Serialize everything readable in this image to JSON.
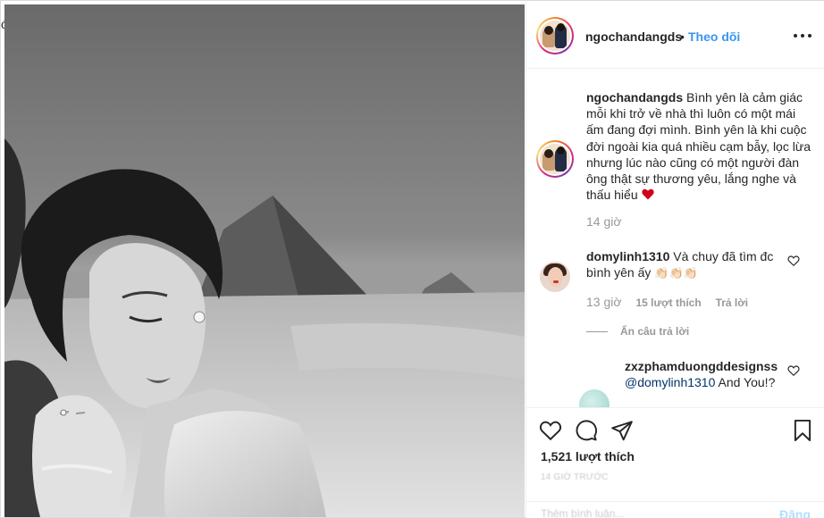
{
  "window": {
    "edge_glyph": "ó"
  },
  "post": {
    "photo_alt": "",
    "author": {
      "username": "ngochandangds",
      "separator": "•",
      "follow_label": "Theo dõi"
    },
    "caption": {
      "username": "ngochandangds",
      "text": "Bình yên là cảm giác mỗi khi trở về nhà thì luôn có một mái ấm đang đợi mình. Bình yên là khi cuộc đời ngoài kia quá nhiều cạm bẫy, lọc lừa nhưng lúc nào cũng có một người đàn ông thật sự thương yêu, lắng nghe và thấu hiểu",
      "emoji": "heart",
      "time": "14 giờ"
    },
    "comments": [
      {
        "username": "domylinh1310",
        "text": "Và chuy đã tìm đc bình yên ấy",
        "emoji": "👏🏻👏🏻👏🏻",
        "time": "13 giờ",
        "likes": "15 lượt thích",
        "reply_label": "Trả lời",
        "hide_replies_label": "Ẩn câu trả lời",
        "replies": [
          {
            "username": "zxzphamduongddesignss",
            "mention": "@domylinh1310",
            "text": " And You!?"
          }
        ]
      }
    ],
    "likes_count": "1,521 lượt thích",
    "timestamp": "14 GIỜ TRƯỚC",
    "add_comment_placeholder": "Thêm bình luận...",
    "post_button": "Đăng"
  },
  "colors": {
    "link_blue": "#3897f0",
    "text": "#262626",
    "muted": "#999999",
    "heart_red": "#ed4956"
  },
  "icons": [
    "more-options-icon",
    "heart-icon",
    "comment-icon",
    "share-icon",
    "bookmark-icon",
    "like-comment-icon"
  ]
}
